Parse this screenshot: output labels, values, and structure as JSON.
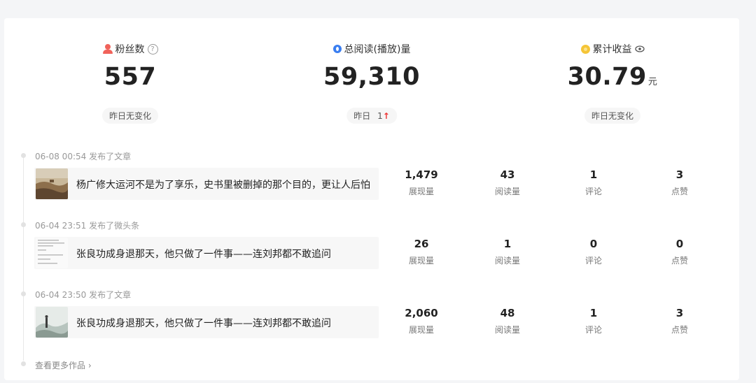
{
  "stats": {
    "fans": {
      "label": "粉丝数",
      "value": "557",
      "change": "昨日无变化"
    },
    "reads": {
      "label": "总阅读(播放)量",
      "value": "59,310",
      "change_prefix": "昨日",
      "change_value": "1",
      "change_arrow": "↑"
    },
    "income": {
      "label": "累计收益",
      "value": "30.79",
      "unit": "元",
      "change": "昨日无变化"
    }
  },
  "items": [
    {
      "meta": "06-08 00:54  发布了文章",
      "title": "杨广修大运河不是为了享乐，史书里被删掉的那个目的，更让人后怕",
      "metrics": [
        {
          "num": "1,479",
          "label": "展现量"
        },
        {
          "num": "43",
          "label": "阅读量"
        },
        {
          "num": "1",
          "label": "评论"
        },
        {
          "num": "3",
          "label": "点赞"
        }
      ]
    },
    {
      "meta": "06-04 23:51  发布了微头条",
      "title": "张良功成身退那天，他只做了一件事——连刘邦都不敢追问",
      "metrics": [
        {
          "num": "26",
          "label": "展现量"
        },
        {
          "num": "1",
          "label": "阅读量"
        },
        {
          "num": "0",
          "label": "评论"
        },
        {
          "num": "0",
          "label": "点赞"
        }
      ]
    },
    {
      "meta": "06-04 23:50  发布了文章",
      "title": "张良功成身退那天，他只做了一件事——连刘邦都不敢追问",
      "metrics": [
        {
          "num": "2,060",
          "label": "展现量"
        },
        {
          "num": "48",
          "label": "阅读量"
        },
        {
          "num": "1",
          "label": "评论"
        },
        {
          "num": "3",
          "label": "点赞"
        }
      ]
    }
  ],
  "more_label": "查看更多作品",
  "icons": {
    "fans": "user-icon",
    "fans_help": "question-icon",
    "reads": "drop-icon",
    "income": "coin-icon",
    "income_eye": "eye-icon",
    "more": "chevron-right-icon"
  }
}
